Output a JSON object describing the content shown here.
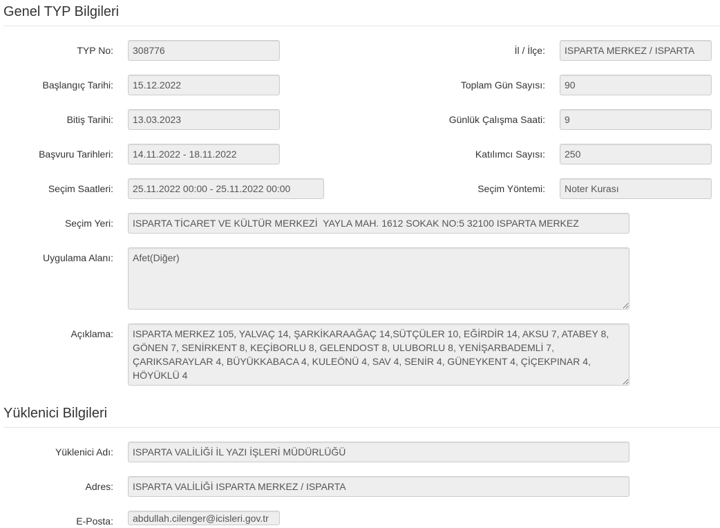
{
  "genel": {
    "title": "Genel TYP Bilgileri",
    "typ_no": {
      "label": "TYP No:",
      "value": "308776"
    },
    "il_ilce": {
      "label": "İl / İlçe:",
      "value": "ISPARTA MERKEZ / ISPARTA"
    },
    "baslangic": {
      "label": "Başlangıç Tarihi:",
      "value": "15.12.2022"
    },
    "toplam_gun": {
      "label": "Toplam Gün Sayısı:",
      "value": "90"
    },
    "bitis": {
      "label": "Bitiş Tarihi:",
      "value": "13.03.2023"
    },
    "gunluk_saat": {
      "label": "Günlük Çalışma Saati:",
      "value": "9"
    },
    "basvuru": {
      "label": "Başvuru Tarihleri:",
      "value": "14.11.2022 - 18.11.2022"
    },
    "katilimci": {
      "label": "Katılımcı Sayısı:",
      "value": "250"
    },
    "secim_saatleri": {
      "label": "Seçim Saatleri:",
      "value": "25.11.2022 00:00 - 25.11.2022 00:00"
    },
    "secim_yontemi": {
      "label": "Seçim Yöntemi:",
      "value": "Noter Kurası"
    },
    "secim_yeri": {
      "label": "Seçim Yeri:",
      "value": "ISPARTA TİCARET VE KÜLTÜR MERKEZİ  YAYLA MAH. 1612 SOKAK NO:5 32100 ISPARTA MERKEZ"
    },
    "uygulama_alani": {
      "label": "Uygulama Alanı:",
      "value": "Afet(Diğer)"
    },
    "aciklama": {
      "label": "Açıklama:",
      "value": "ISPARTA MERKEZ 105, YALVAÇ 14, ŞARKİKARAAĞAÇ 14,SÜTÇÜLER 10, EĞİRDİR 14, AKSU 7, ATABEY 8, GÖNEN 7, SENİRKENT 8, KEÇİBORLU 8, GELENDOST 8, ULUBORLU 8, YENİŞARBADEMLİ 7, ÇARIKSARAYLAR 4, BÜYÜKKABACA 4, KULEÖNÜ 4, SAV 4, SENİR 4, GÜNEYKENT 4, ÇİÇEKPINAR 4, HÖYÜKLÜ 4"
    }
  },
  "yuklenici": {
    "title": "Yüklenici Bilgileri",
    "adi": {
      "label": "Yüklenici Adı:",
      "value": "ISPARTA VALİLİĞİ İL YAZI İŞLERİ MÜDÜRLÜĞÜ"
    },
    "adres": {
      "label": "Adres:",
      "value": "ISPARTA VALİLİĞİ ISPARTA MERKEZ / ISPARTA"
    },
    "eposta": {
      "label": "E-Posta:",
      "value": "abdullah.cilenger@icisleri.gov.tr"
    }
  }
}
